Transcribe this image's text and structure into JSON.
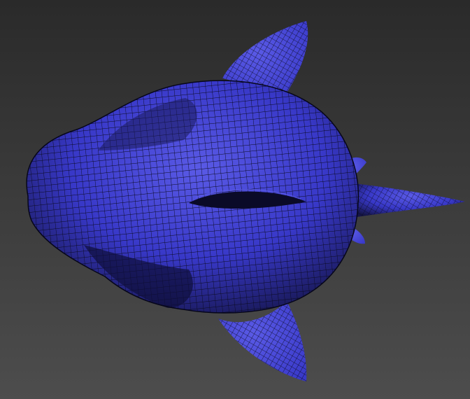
{
  "viewport": {
    "background_top": "#2a2a2a",
    "background_bottom": "#4d4d4d"
  },
  "model": {
    "object": "shark",
    "render_mode": "wireframe-on-shaded",
    "surface_color": "#3838c8",
    "surface_highlight": "#5a5ae6",
    "surface_shadow": "#141446",
    "wire_color": "#0a0a1e"
  }
}
